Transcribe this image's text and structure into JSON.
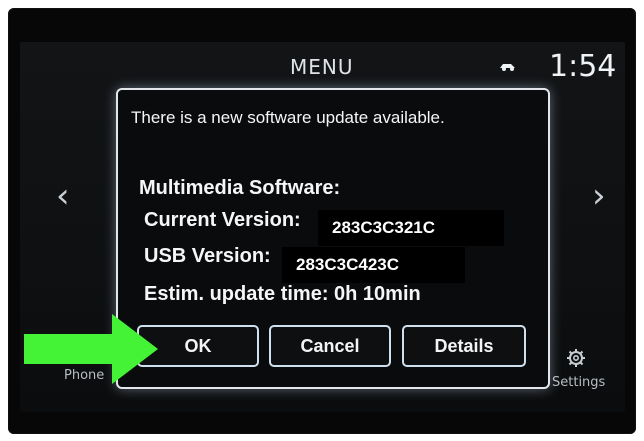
{
  "header": {
    "title": "MENU",
    "clock": "1:54",
    "status_icon": "car-icon"
  },
  "nav": {
    "left_arrow": "‹",
    "right_arrow": "›"
  },
  "bottom": {
    "phone_label": "Phone",
    "settings_label": "Settings"
  },
  "dialog": {
    "message": "There is a new software update available.",
    "software_label": "Multimedia Software:",
    "current_version_label": "Current Version:",
    "current_version_value": "283C3C321C",
    "usb_version_label": "USB Version:",
    "usb_version_value": "283C3C423C",
    "estimate_label": "Estim. update time:  0h 10min",
    "buttons": {
      "ok": "OK",
      "cancel": "Cancel",
      "details": "Details"
    }
  },
  "annotation": {
    "arrow_color": "#44f236",
    "arrow_icon": "right-arrow-icon"
  }
}
